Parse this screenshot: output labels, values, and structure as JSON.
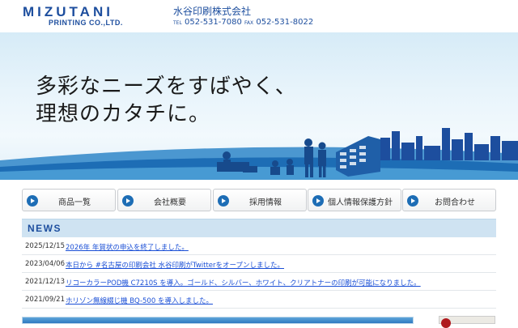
{
  "header": {
    "logo_top": "MIZUTANI",
    "logo_bottom": "PRINTING CO.,LTD.",
    "company_name": "水谷印刷株式会社",
    "tel_label": "TEL",
    "tel": "052-531-7080",
    "fax_label": "FAX",
    "fax": "052-531-8022"
  },
  "hero": {
    "line1": "多彩なニーズをすばやく、",
    "line2": "理想のカタチに。"
  },
  "nav": {
    "items": [
      {
        "label": "商品一覧"
      },
      {
        "label": "会社概要"
      },
      {
        "label": "採用情報"
      },
      {
        "label": "個人情報保護方針"
      },
      {
        "label": "お問合わせ"
      }
    ]
  },
  "news": {
    "title": "NEWS",
    "items": [
      {
        "date": "2025/12/15",
        "text": "2026年 年賀状の申込を終了しました。"
      },
      {
        "date": "2023/04/06",
        "text": "本日から #名古屋の印刷会社 水谷印刷がTwitterをオープンしました。"
      },
      {
        "date": "2021/12/13",
        "text": "リコーカラーPOD機 C7210S を導入。ゴールド、シルバー、ホワイト、クリアトナーの印刷が可能になりました。"
      },
      {
        "date": "2021/09/21",
        "text": "ホリゾン無線綴じ機 BQ-500 を導入しました。"
      }
    ]
  },
  "colors": {
    "brand": "#1d4e9e",
    "nav_dot": "#1d6db5",
    "link": "#1a4fd6",
    "news_header_bg": "#cfe3f2"
  }
}
